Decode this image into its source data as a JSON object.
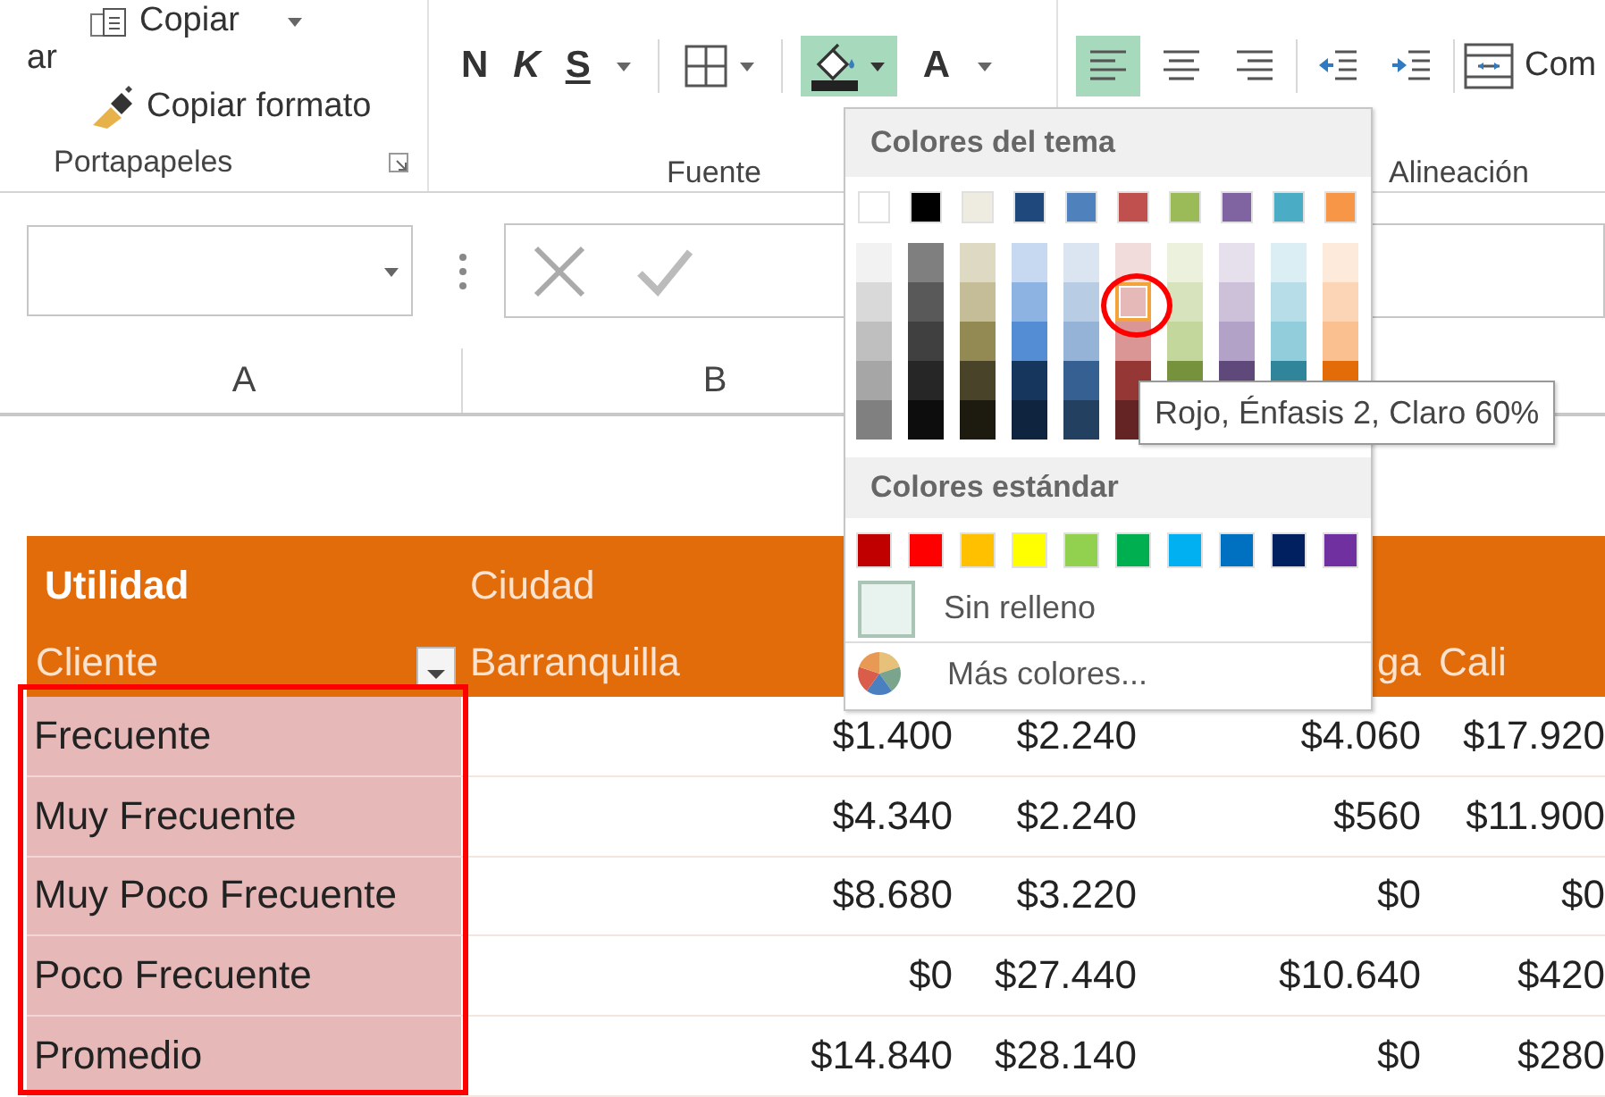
{
  "ribbon": {
    "clipboard": {
      "paste_label": "ar",
      "copy_label": "Copiar",
      "format_painter_label": "Copiar formato",
      "group_label": "Portapapeles"
    },
    "font": {
      "bold_label": "N",
      "italic_label": "K",
      "underline_label": "S",
      "fill_button": {
        "expanded": true
      },
      "font_color_label": "A",
      "group_label": "Fuente"
    },
    "alignment": {
      "buttons": [
        {
          "kind": "align-left",
          "selected": true
        },
        {
          "kind": "align-center",
          "selected": false
        },
        {
          "kind": "align-right",
          "selected": false
        },
        {
          "kind": "decrease-indent",
          "selected": false
        },
        {
          "kind": "increase-indent",
          "selected": false
        }
      ],
      "merge_label": "Com",
      "group_label": "Alineación"
    }
  },
  "column_headers": [
    "A",
    "B"
  ],
  "table": {
    "title_cells": [
      "Utilidad",
      "Ciudad"
    ],
    "row_field": {
      "label": "Cliente",
      "filter": true
    },
    "column_labels": [
      "Barranquilla",
      "ga",
      "Cali"
    ],
    "rows": [
      {
        "label": "Frecuente",
        "values": [
          "$1.400",
          "$2.240",
          "$4.060",
          "$17.920"
        ]
      },
      {
        "label": "Muy Frecuente",
        "values": [
          "$4.340",
          "$2.240",
          "$560",
          "$11.900"
        ]
      },
      {
        "label": "Muy Poco Frecuente",
        "values": [
          "$8.680",
          "$3.220",
          "$0",
          "$0"
        ]
      },
      {
        "label": "Poco Frecuente",
        "values": [
          "$0",
          "$27.440",
          "$10.640",
          "$420"
        ]
      },
      {
        "label": "Promedio",
        "values": [
          "$14.840",
          "$28.140",
          "$0",
          "$280"
        ]
      }
    ]
  },
  "palette": {
    "theme_title": "Colores del tema",
    "theme_colors": [
      {
        "color": "#ffffff",
        "selected": false,
        "shades": [
          {
            "color": "#f2f2f2",
            "selected": false
          },
          {
            "color": "#d9d9d9",
            "selected": false
          },
          {
            "color": "#bfbfbf",
            "selected": false
          },
          {
            "color": "#a6a6a6",
            "selected": false
          },
          {
            "color": "#808080",
            "selected": false
          }
        ]
      },
      {
        "color": "#000000",
        "selected": false,
        "shades": [
          {
            "color": "#7f7f7f",
            "selected": false
          },
          {
            "color": "#595959",
            "selected": false
          },
          {
            "color": "#404040",
            "selected": false
          },
          {
            "color": "#262626",
            "selected": false
          },
          {
            "color": "#0d0d0d",
            "selected": false
          }
        ]
      },
      {
        "color": "#eeece1",
        "selected": false,
        "shades": [
          {
            "color": "#ddd9c3",
            "selected": false
          },
          {
            "color": "#c4bd97",
            "selected": false
          },
          {
            "color": "#938953",
            "selected": false
          },
          {
            "color": "#494429",
            "selected": false
          },
          {
            "color": "#1d1b10",
            "selected": false
          }
        ]
      },
      {
        "color": "#1f497d",
        "selected": false,
        "shades": [
          {
            "color": "#c6d9f0",
            "selected": false
          },
          {
            "color": "#8db3e2",
            "selected": false
          },
          {
            "color": "#548dd4",
            "selected": false
          },
          {
            "color": "#17365d",
            "selected": false
          },
          {
            "color": "#0f243e",
            "selected": false
          }
        ]
      },
      {
        "color": "#4f81bd",
        "selected": false,
        "shades": [
          {
            "color": "#dbe5f1",
            "selected": false
          },
          {
            "color": "#b8cce4",
            "selected": false
          },
          {
            "color": "#95b3d7",
            "selected": false
          },
          {
            "color": "#366092",
            "selected": false
          },
          {
            "color": "#244061",
            "selected": false
          }
        ]
      },
      {
        "color": "#c0504d",
        "selected": false,
        "shades": [
          {
            "color": "#f2dcdb",
            "selected": false
          },
          {
            "color": "#e5b9b7",
            "selected": true
          },
          {
            "color": "#d99694",
            "selected": false
          },
          {
            "color": "#953734",
            "selected": false
          },
          {
            "color": "#632423",
            "selected": false
          }
        ]
      },
      {
        "color": "#9bbb59",
        "selected": false,
        "shades": [
          {
            "color": "#ebf1dd",
            "selected": false
          },
          {
            "color": "#d7e3bc",
            "selected": false
          },
          {
            "color": "#c3d69b",
            "selected": false
          },
          {
            "color": "#76923c",
            "selected": false
          }
        ]
      },
      {
        "color": "#8064a2",
        "selected": false,
        "shades": [
          {
            "color": "#e5e0ec",
            "selected": false
          },
          {
            "color": "#ccc1d9",
            "selected": false
          },
          {
            "color": "#b2a2c7",
            "selected": false
          },
          {
            "color": "#5f497a",
            "selected": false
          }
        ]
      },
      {
        "color": "#4bacc6",
        "selected": false,
        "shades": [
          {
            "color": "#dbeef3",
            "selected": false
          },
          {
            "color": "#b7dde8",
            "selected": false
          },
          {
            "color": "#92cddc",
            "selected": false
          },
          {
            "color": "#31859b",
            "selected": false
          }
        ]
      },
      {
        "color": "#f79646",
        "selected": false,
        "shades": [
          {
            "color": "#fdeada",
            "selected": false
          },
          {
            "color": "#fbd5b5",
            "selected": false
          },
          {
            "color": "#fac08f",
            "selected": false
          },
          {
            "color": "#e36c09",
            "selected": false
          }
        ]
      }
    ],
    "standard_title": "Colores estándar",
    "standard_colors": [
      {
        "color": "#c00000",
        "selected": false
      },
      {
        "color": "#ff0000",
        "selected": false
      },
      {
        "color": "#ffc000",
        "selected": false
      },
      {
        "color": "#ffff00",
        "selected": false
      },
      {
        "color": "#92d050",
        "selected": false
      },
      {
        "color": "#00b050",
        "selected": false
      },
      {
        "color": "#00b0f0",
        "selected": false
      },
      {
        "color": "#0070c0",
        "selected": false
      },
      {
        "color": "#002060",
        "selected": false
      },
      {
        "color": "#7030a0",
        "selected": false
      }
    ],
    "no_fill_label": "Sin relleno",
    "more_colors_label": "Más colores...",
    "tooltip": "Rojo, Énfasis 2, Claro 60%"
  }
}
